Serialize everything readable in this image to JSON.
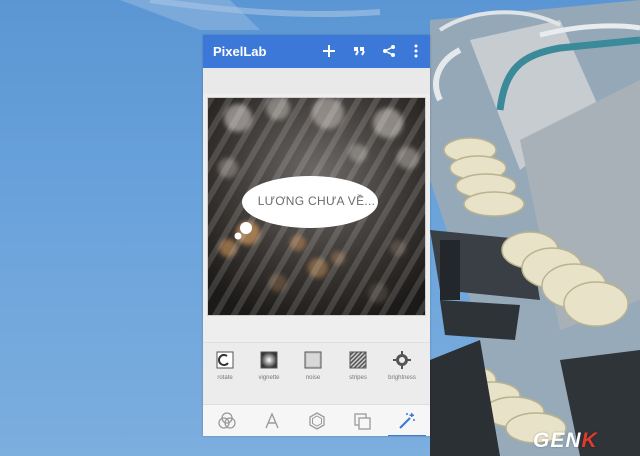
{
  "app": {
    "title": "PixelLab",
    "toolbar_icons": [
      "plus-icon",
      "quote-icon",
      "share-icon",
      "more-vert-icon"
    ]
  },
  "canvas": {
    "bubble_text": "LƯƠNG CHƯA VỀ..."
  },
  "effects": [
    {
      "label": "rotate",
      "icon": "rotate-icon"
    },
    {
      "label": "vignette",
      "icon": "vignette-icon"
    },
    {
      "label": "noise",
      "icon": "noise-icon"
    },
    {
      "label": "stripes",
      "icon": "stripes-icon"
    },
    {
      "label": "brightness",
      "icon": "brightness-icon"
    }
  ],
  "bottom_nav": {
    "items": [
      "blend-icon",
      "text-icon",
      "shape-icon",
      "layers-icon",
      "effects-wand-icon"
    ],
    "active": "effects-wand-icon"
  },
  "watermark": {
    "text_main": "GEN",
    "text_accent": "K"
  },
  "colors": {
    "appbar": "#3c78d8",
    "accent": "#3c78d8",
    "watermark_accent": "#e23b2e"
  }
}
